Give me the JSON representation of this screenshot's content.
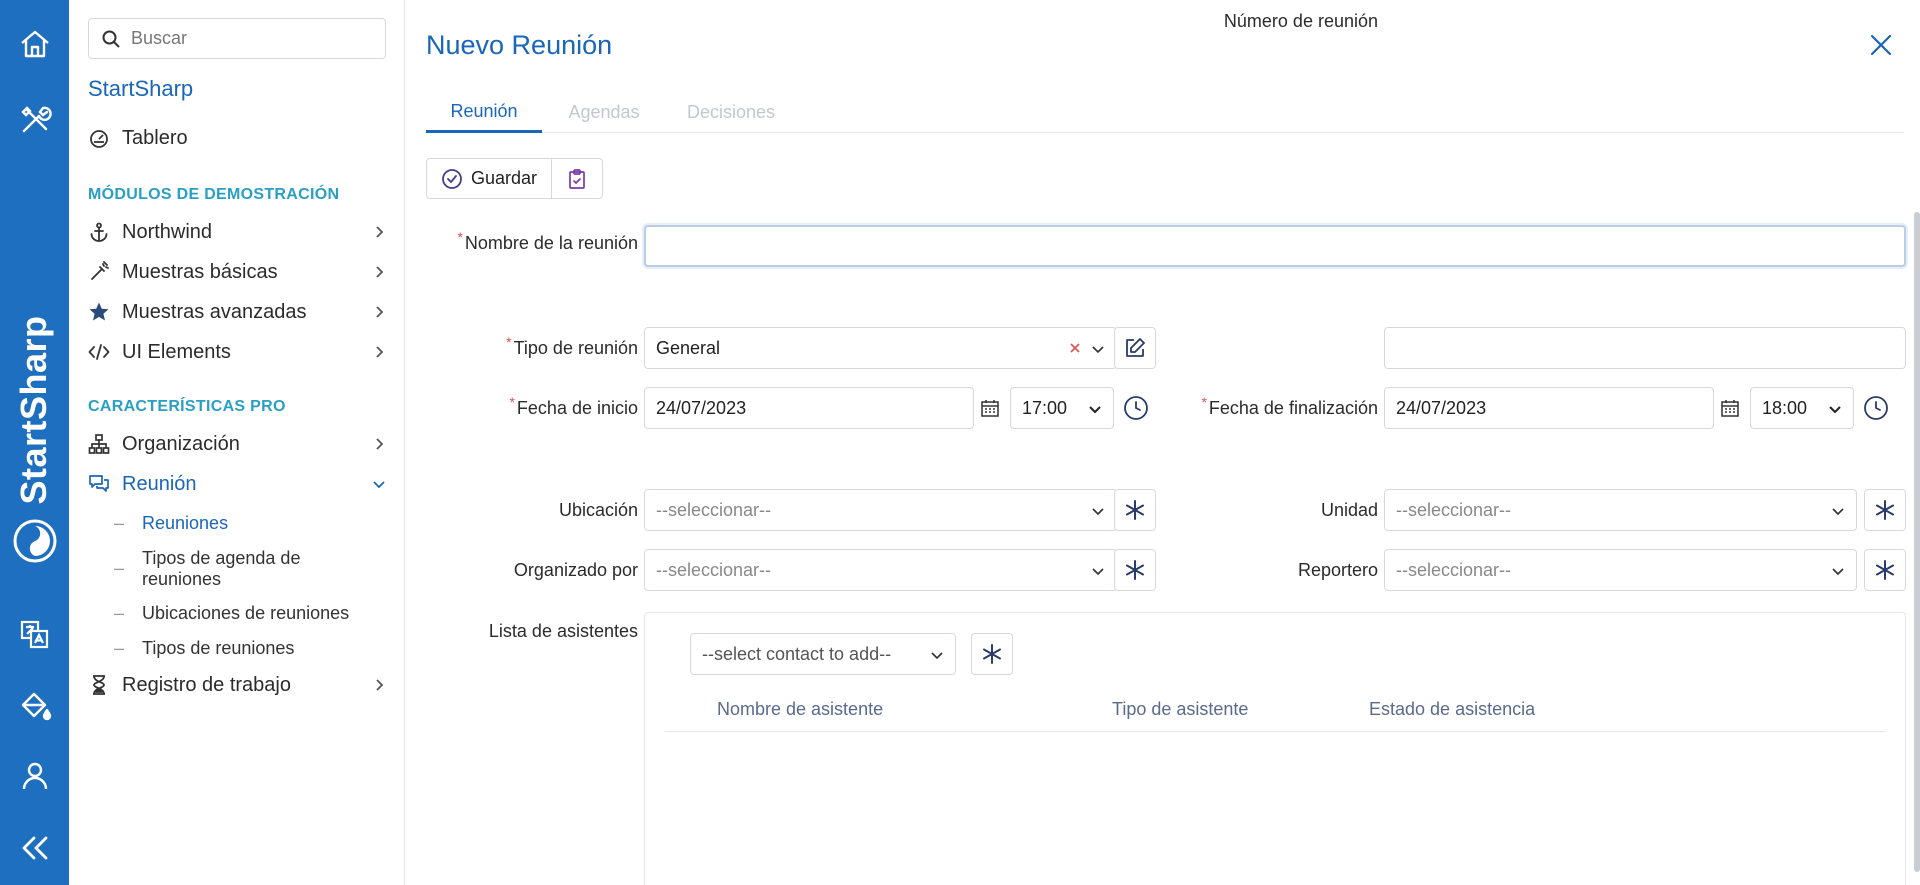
{
  "rail": {
    "brand_text": "StartSharp",
    "icons": [
      "home-icon",
      "tools-icon",
      "translate-icon",
      "paint-bucket-icon",
      "user-icon",
      "double-chevron-left-icon"
    ]
  },
  "sidebar": {
    "search_placeholder": "Buscar",
    "brand": "StartSharp",
    "dashboard": "Tablero",
    "demo_section": "MÓDULOS DE DEMOSTRACIÓN",
    "demo_items": [
      "Northwind",
      "Muestras básicas",
      "Muestras avanzadas",
      "UI Elements"
    ],
    "pro_section": "CARACTERÍSTICAS PRO",
    "organization": "Organización",
    "meeting": "Reunión",
    "meeting_subitems": [
      "Reuniones",
      "Tipos de agenda de reuniones",
      "Ubicaciones de reuniones",
      "Tipos de reuniones"
    ],
    "work_log": "Registro de trabajo"
  },
  "dialog": {
    "title": "Nuevo Reunión",
    "tabs": [
      "Reunión",
      "Agendas",
      "Decisiones"
    ],
    "active_tab": "Reunión",
    "save_label": "Guardar"
  },
  "form": {
    "name_label": "Nombre de la reunión",
    "name_value": "",
    "type_label": "Tipo de reunión",
    "type_value": "General",
    "number_label": "Número de reunión",
    "number_value": "",
    "start_label": "Fecha de inicio",
    "start_date": "24/07/2023",
    "start_time": "17:00",
    "end_label": "Fecha de finalización",
    "end_date": "24/07/2023",
    "end_time": "18:00",
    "location_label": "Ubicación",
    "unit_label": "Unidad",
    "organizer_label": "Organizado por",
    "reporter_label": "Reportero",
    "select_placeholder": "--seleccionar--",
    "attendees_label": "Lista de asistentes",
    "contact_placeholder": "--select contact to add--",
    "attendee_columns": [
      "Nombre de asistente",
      "Tipo de asistente",
      "Estado de asistencia"
    ]
  },
  "colors": {
    "rail": "#1e6fc0",
    "accent": "#1a66b8",
    "section": "#2a9fc4",
    "required": "#d9534f"
  }
}
